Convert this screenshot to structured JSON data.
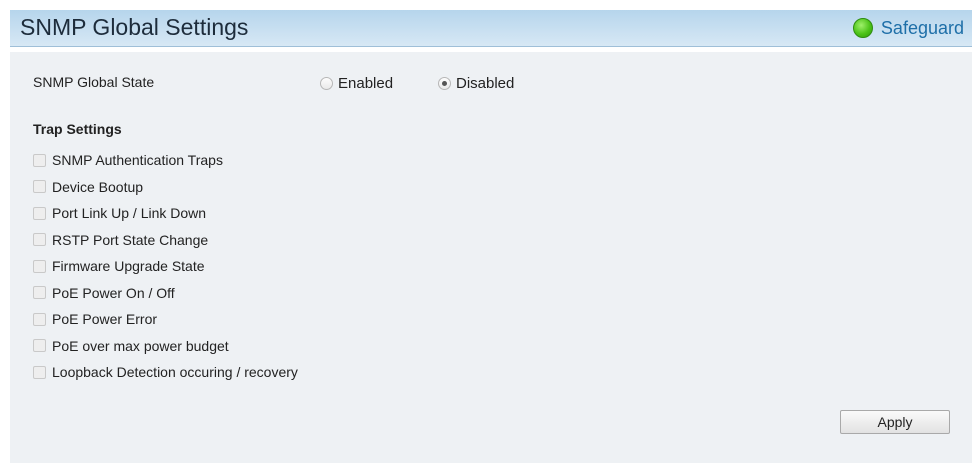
{
  "header": {
    "title": "SNMP Global Settings",
    "safeguard_label": "Safeguard",
    "safeguard_color": "#4cc318"
  },
  "snmp_global_state": {
    "label": "SNMP Global State",
    "options": [
      {
        "label": "Enabled",
        "checked": false
      },
      {
        "label": "Disabled",
        "checked": true
      }
    ]
  },
  "trap_settings": {
    "heading": "Trap Settings",
    "items": [
      {
        "label": "SNMP Authentication Traps",
        "checked": false
      },
      {
        "label": "Device Bootup",
        "checked": false
      },
      {
        "label": "Port Link Up / Link Down",
        "checked": false
      },
      {
        "label": "RSTP Port State Change",
        "checked": false
      },
      {
        "label": "Firmware Upgrade State",
        "checked": false
      },
      {
        "label": "PoE Power On / Off",
        "checked": false
      },
      {
        "label": "PoE Power Error",
        "checked": false
      },
      {
        "label": "PoE over max power budget",
        "checked": false
      },
      {
        "label": "Loopback Detection occuring / recovery",
        "checked": false
      }
    ]
  },
  "actions": {
    "apply_label": "Apply"
  }
}
